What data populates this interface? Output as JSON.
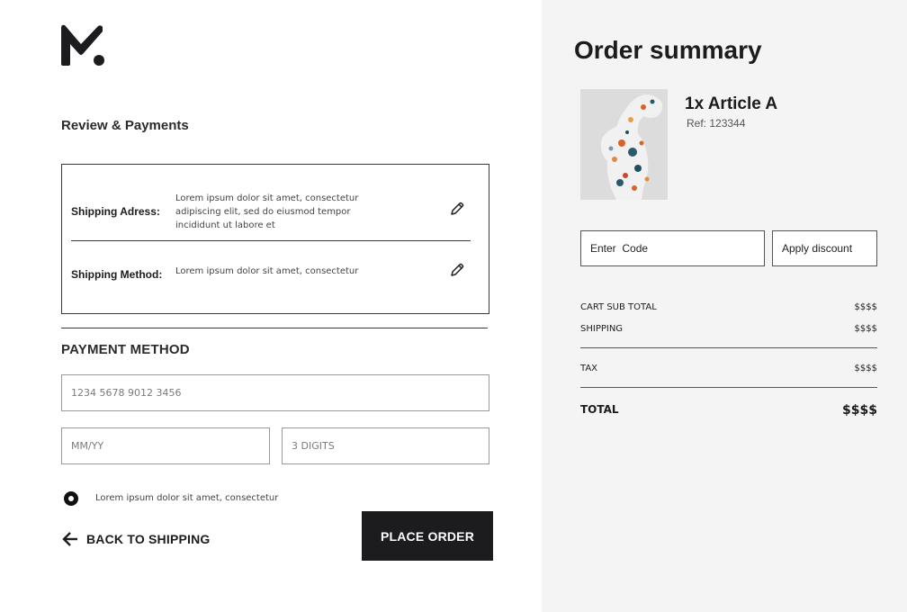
{
  "brand": {
    "logo_icon": "brand-m-logo-icon"
  },
  "review": {
    "title": "Review & Payments",
    "shipping_address_label": "Shipping Adress:",
    "shipping_address_text": "Lorem ipsum dolor sit amet, consectetur adipiscing elit, sed do eiusmod tempor incididunt ut labore et",
    "shipping_method_label": "Shipping Method:",
    "shipping_method_text": "Lorem ipsum dolor sit amet, consectetur",
    "edit_icon": "pencil-icon"
  },
  "payment": {
    "title": "PAYMENT METHOD",
    "card_number_placeholder": "1234 5678 9012 3456",
    "expiry_placeholder": "MM/YY",
    "cvv_placeholder": "3 DIGITS",
    "radio_label": "Lorem ipsum dolor sit amet, consectetur"
  },
  "actions": {
    "back_label": "BACK TO SHIPPING",
    "back_icon": "arrow-left-icon",
    "place_order_label": "PLACE ORDER"
  },
  "summary": {
    "title": "Order summary",
    "product_name": "1x Article A",
    "product_ref": "Ref: 123344",
    "code_placeholder": "Enter  Code",
    "apply_label": "Apply discount",
    "rows": [
      {
        "label": "CART SUB TOTAL",
        "value": "$$$$"
      },
      {
        "label": "SHIPPING",
        "value": "$$$$"
      },
      {
        "label": "TAX",
        "value": "$$$$"
      }
    ],
    "total_label": "TOTAL",
    "total_value": "$$$$"
  },
  "colors": {
    "accent": "#1c1c1e",
    "panel_bg": "#f4f4f4"
  }
}
